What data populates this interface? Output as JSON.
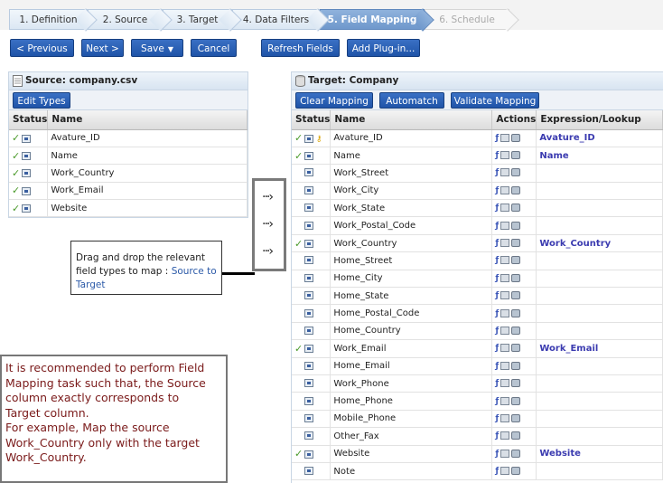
{
  "wizard": {
    "steps": [
      {
        "label": "1. Definition",
        "state": "done"
      },
      {
        "label": "2. Source",
        "state": "done"
      },
      {
        "label": "3. Target",
        "state": "done"
      },
      {
        "label": "4. Data Filters",
        "state": "done"
      },
      {
        "label": "5. Field Mapping",
        "state": "active"
      },
      {
        "label": "6. Schedule",
        "state": "disabled"
      }
    ]
  },
  "toolbar": {
    "previous": "< Previous",
    "next": "Next >",
    "save": "Save",
    "cancel": "Cancel",
    "refresh_fields": "Refresh Fields",
    "add_plugin": "Add Plug-in..."
  },
  "source": {
    "title": "Source: company.csv",
    "edit_types": "Edit Types",
    "columns": [
      "Status",
      "Name"
    ],
    "rows": [
      {
        "name": "Avature_ID",
        "mapped": true
      },
      {
        "name": "Name",
        "mapped": true
      },
      {
        "name": "Work_Country",
        "mapped": true
      },
      {
        "name": "Work_Email",
        "mapped": true
      },
      {
        "name": "Website",
        "mapped": true
      }
    ]
  },
  "target": {
    "title": "Target: Company",
    "clear_mapping": "Clear Mapping",
    "automatch": "Automatch",
    "validate_mapping": "Validate Mapping",
    "columns": [
      "Status",
      "Name",
      "Actions",
      "Expression/Lookup"
    ],
    "rows": [
      {
        "name": "Avature_ID",
        "mapped": true,
        "key": true,
        "expr": "Avature_ID"
      },
      {
        "name": "Name",
        "mapped": true,
        "key": false,
        "expr": "Name"
      },
      {
        "name": "Work_Street",
        "mapped": false,
        "key": false,
        "expr": ""
      },
      {
        "name": "Work_City",
        "mapped": false,
        "key": false,
        "expr": ""
      },
      {
        "name": "Work_State",
        "mapped": false,
        "key": false,
        "expr": ""
      },
      {
        "name": "Work_Postal_Code",
        "mapped": false,
        "key": false,
        "expr": ""
      },
      {
        "name": "Work_Country",
        "mapped": true,
        "key": false,
        "expr": "Work_Country"
      },
      {
        "name": "Home_Street",
        "mapped": false,
        "key": false,
        "expr": ""
      },
      {
        "name": "Home_City",
        "mapped": false,
        "key": false,
        "expr": ""
      },
      {
        "name": "Home_State",
        "mapped": false,
        "key": false,
        "expr": ""
      },
      {
        "name": "Home_Postal_Code",
        "mapped": false,
        "key": false,
        "expr": ""
      },
      {
        "name": "Home_Country",
        "mapped": false,
        "key": false,
        "expr": ""
      },
      {
        "name": "Work_Email",
        "mapped": true,
        "key": false,
        "expr": "Work_Email"
      },
      {
        "name": "Home_Email",
        "mapped": false,
        "key": false,
        "expr": ""
      },
      {
        "name": "Work_Phone",
        "mapped": false,
        "key": false,
        "expr": ""
      },
      {
        "name": "Home_Phone",
        "mapped": false,
        "key": false,
        "expr": ""
      },
      {
        "name": "Mobile_Phone",
        "mapped": false,
        "key": false,
        "expr": ""
      },
      {
        "name": "Other_Fax",
        "mapped": false,
        "key": false,
        "expr": ""
      },
      {
        "name": "Website",
        "mapped": true,
        "key": false,
        "expr": "Website"
      },
      {
        "name": "Note",
        "mapped": false,
        "key": false,
        "expr": ""
      }
    ]
  },
  "callout_drag": {
    "text": "Drag and drop the relevant field types to map : ",
    "link": "Source to Target"
  },
  "callout_note": {
    "lines": [
      "It is recommended to perform Field",
      "Mapping task such that, the Source",
      "column exactly corresponds to",
      "Target column.",
      "For example, Map the  source",
      "Work_Country  only with the target",
      "Work_Country."
    ]
  },
  "colors": {
    "button": "#2a5fb5",
    "active_step": "#7aa3d4",
    "note_text": "#7a1a1a",
    "expression_text": "#3b3bb0",
    "check": "#4a9a2a"
  }
}
